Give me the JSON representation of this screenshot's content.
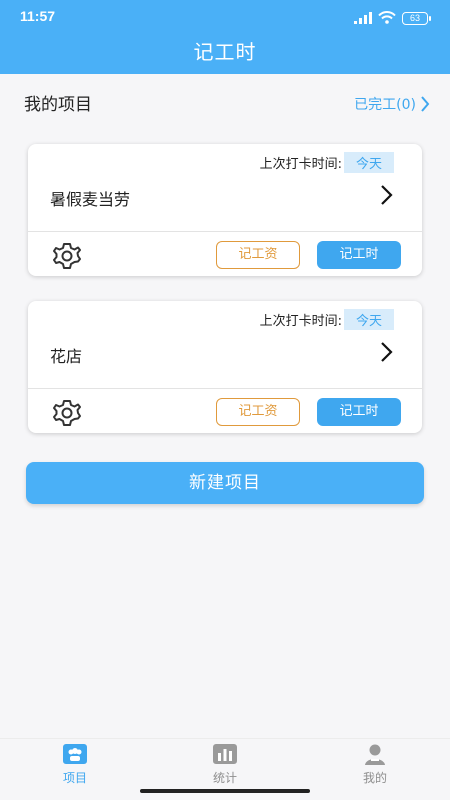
{
  "status": {
    "time": "11:57",
    "battery": "63"
  },
  "header": {
    "title": "记工时"
  },
  "section": {
    "title": "我的项目",
    "done_link": "已完工(0)"
  },
  "projects": [
    {
      "name": "暑假麦当劳",
      "last_punch_label": "上次打卡时间:",
      "last_punch_value": "今天",
      "wage_button": "记工资",
      "hours_button": "记工时"
    },
    {
      "name": "花店",
      "last_punch_label": "上次打卡时间:",
      "last_punch_value": "今天",
      "wage_button": "记工资",
      "hours_button": "记工时"
    }
  ],
  "new_project_button": "新建项目",
  "tabs": [
    {
      "label": "项目",
      "icon": "projects-icon",
      "active": true
    },
    {
      "label": "统计",
      "icon": "stats-icon",
      "active": false
    },
    {
      "label": "我的",
      "icon": "profile-icon",
      "active": false
    }
  ],
  "colors": {
    "primary": "#4ab0f7",
    "accent_blue": "#3fa7ef",
    "wage_orange": "#e09a3c",
    "today_bg": "#d8ecfb"
  }
}
